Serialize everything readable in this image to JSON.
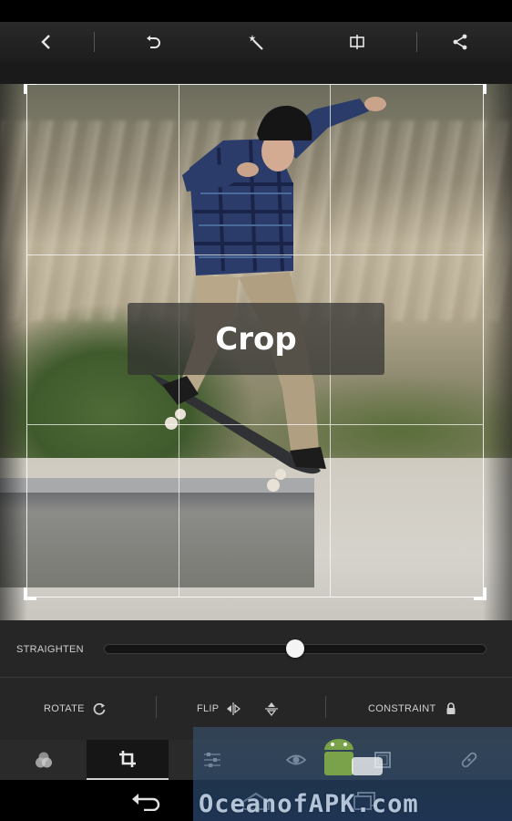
{
  "toolbar": {
    "back_icon": "chevron-left-icon",
    "undo_icon": "undo-icon",
    "auto_icon": "magic-wand-icon",
    "compare_icon": "compare-icon",
    "share_icon": "share-icon"
  },
  "crop_overlay": {
    "label": "Crop"
  },
  "straighten": {
    "label": "STRAIGHTEN",
    "value": 0.5
  },
  "tools": {
    "rotate_label": "ROTATE",
    "flip_label": "FLIP",
    "constraint_label": "CONSTRAINT"
  },
  "modes": [
    {
      "name": "color-filters",
      "icon": "filters-icon",
      "active": false
    },
    {
      "name": "crop",
      "icon": "crop-icon",
      "active": true
    },
    {
      "name": "adjust",
      "icon": "sliders-icon",
      "active": false
    },
    {
      "name": "red-eye",
      "icon": "eye-icon",
      "active": false
    },
    {
      "name": "frame",
      "icon": "frame-icon",
      "active": false
    },
    {
      "name": "heal",
      "icon": "bandage-icon",
      "active": false
    }
  ],
  "watermark": {
    "text": "OceanofAPK.com"
  },
  "colors": {
    "accent": "#ffffff",
    "bar_bg": "#262626",
    "active_tab": "#161616"
  }
}
